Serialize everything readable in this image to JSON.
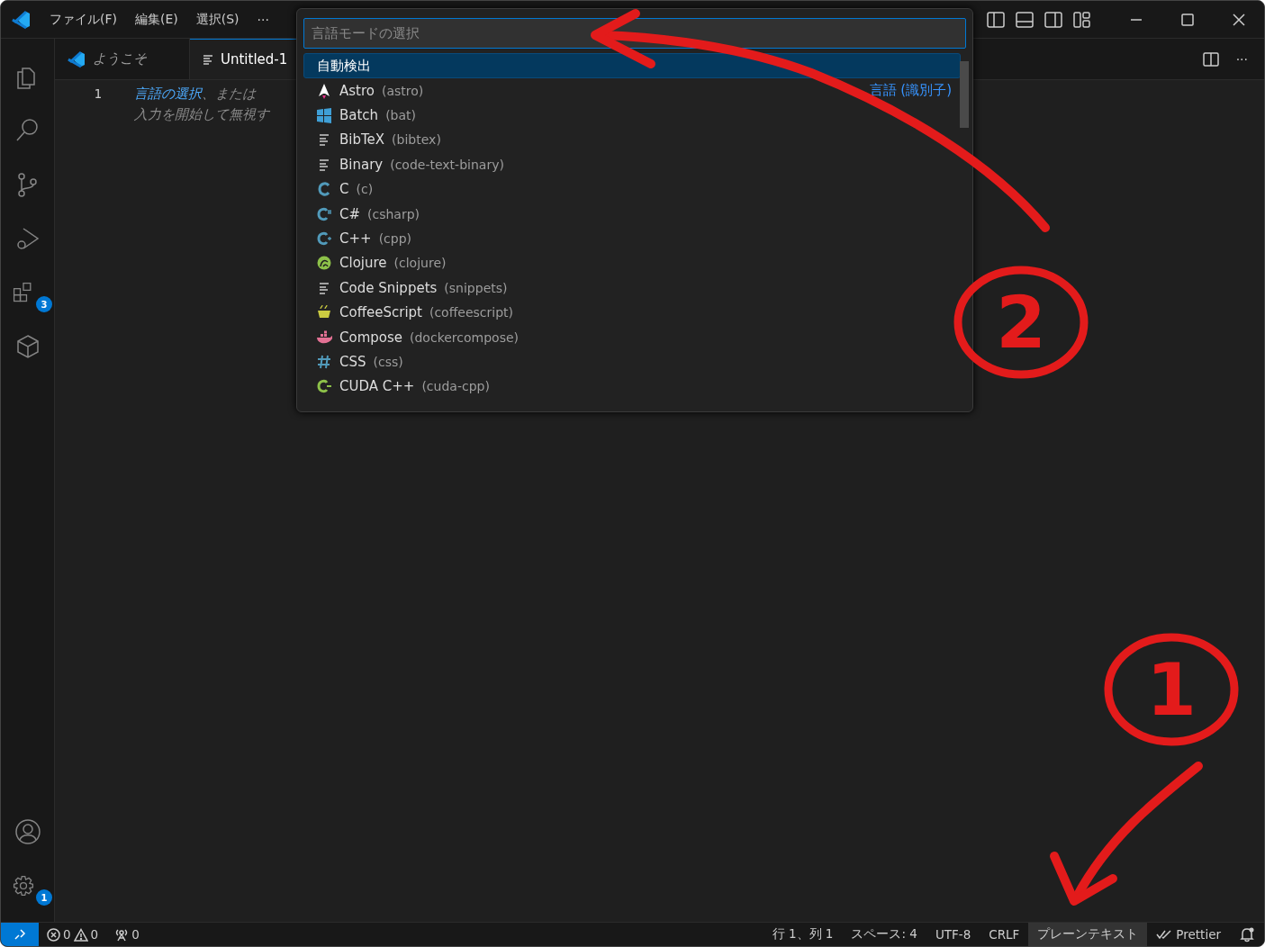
{
  "title_bar": {
    "menus": [
      "ファイル(F)",
      "編集(E)",
      "選択(S)"
    ],
    "more": "···"
  },
  "activity_bar": {
    "items": [
      {
        "kind": "files"
      },
      {
        "kind": "search"
      },
      {
        "kind": "git"
      },
      {
        "kind": "debug"
      },
      {
        "kind": "extensions",
        "badge": "3"
      },
      {
        "kind": "box"
      }
    ],
    "bottom": [
      {
        "kind": "account"
      },
      {
        "kind": "gear",
        "badge": "1"
      }
    ]
  },
  "tabs": [
    {
      "label": "ようこそ",
      "kind": "welcome",
      "selected": false
    },
    {
      "label": "Untitled-1",
      "kind": "file",
      "selected": true
    }
  ],
  "editor": {
    "line_number": "1",
    "hint_link": "言語の選択",
    "hint_rest": "、または",
    "hint_line2": "入力を開始して無視す"
  },
  "palette": {
    "placeholder": "言語モードの選択",
    "top_item": {
      "label": "自動検出",
      "selected": true
    },
    "items": [
      {
        "kind": "astro",
        "label": "Astro",
        "id": "(astro)",
        "detail": "言語 (識別子)"
      },
      {
        "kind": "windows",
        "label": "Batch",
        "id": "(bat)"
      },
      {
        "kind": "lines",
        "label": "BibTeX",
        "id": "(bibtex)"
      },
      {
        "kind": "lines",
        "label": "Binary",
        "id": "(code-text-binary)"
      },
      {
        "kind": "c",
        "label": "C",
        "id": "(c)"
      },
      {
        "kind": "csharp",
        "label": "C#",
        "id": "(csharp)"
      },
      {
        "kind": "cpp",
        "label": "C++",
        "id": "(cpp)"
      },
      {
        "kind": "clojure",
        "label": "Clojure",
        "id": "(clojure)"
      },
      {
        "kind": "lines",
        "label": "Code Snippets",
        "id": "(snippets)"
      },
      {
        "kind": "coffee",
        "label": "CoffeeScript",
        "id": "(coffeescript)"
      },
      {
        "kind": "docker",
        "label": "Compose",
        "id": "(dockercompose)"
      },
      {
        "kind": "hash",
        "label": "CSS",
        "id": "(css)"
      },
      {
        "kind": "cuda",
        "label": "CUDA C++",
        "id": "(cuda-cpp)"
      }
    ]
  },
  "status_bar": {
    "errors": "0",
    "warnings": "0",
    "ports": "0",
    "right_items": [
      {
        "label": "行 1、列 1",
        "selected": false
      },
      {
        "label": "スペース: 4",
        "selected": false
      },
      {
        "label": "UTF-8",
        "selected": false
      },
      {
        "label": "CRLF",
        "selected": false
      },
      {
        "label": "プレーンテキスト",
        "selected": true
      },
      {
        "label": "Prettier",
        "selected": false,
        "kind": "prettier"
      }
    ]
  },
  "annotations": [
    {
      "number": "2",
      "kind": "palette"
    },
    {
      "number": "1",
      "kind": "status"
    }
  ]
}
